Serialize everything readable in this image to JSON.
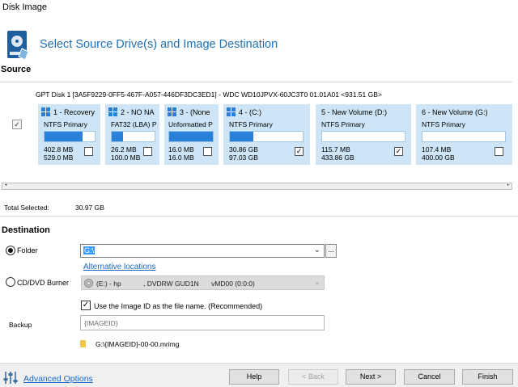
{
  "window": {
    "title": "Disk Image"
  },
  "header": {
    "title": "Select Source Drive(s) and Image Destination",
    "icon": "disk-image-icon"
  },
  "source": {
    "label": "Source",
    "disk_line": "GPT Disk 1 [3A5F9229-0FF5-467F-A057-446DF3DC3ED1] - WDC WD10JPVX-60JC3T0 01.01A01  <931.51 GB>",
    "disk_checked": "✓",
    "partitions": [
      {
        "title": "1 - Recovery",
        "type": "NTFS Primary",
        "used": "402.8 MB",
        "total": "529.0 MB",
        "fill": 0.76,
        "checked": ""
      },
      {
        "title": "2 - NO NA",
        "type": "FAT32 (LBA) P",
        "used": "26.2 MB",
        "total": "100.0 MB",
        "fill": 0.26,
        "checked": ""
      },
      {
        "title": "3 - (None",
        "type": "Unformatted P",
        "used": "16.0 MB",
        "total": "16.0 MB",
        "fill": 1.0,
        "checked": ""
      },
      {
        "title": "4 - (C:)",
        "type": "NTFS Primary",
        "used": "30.86 GB",
        "total": "97.03 GB",
        "fill": 0.32,
        "checked": "✓"
      },
      {
        "title": "5 - New Volume (D:)",
        "type": "NTFS Primary",
        "used": "115.7 MB",
        "total": "433.86 GB",
        "fill": 0.0,
        "checked": "✓"
      },
      {
        "title": "6 - New Volume (G:)",
        "type": "NTFS Primary",
        "used": "107.4 MB",
        "total": "400.00 GB",
        "fill": 0.0,
        "checked": ""
      }
    ],
    "scroll_left": "•",
    "scroll_right": "•"
  },
  "total": {
    "label": "Total Selected:",
    "value": "30.97 GB"
  },
  "destination": {
    "label": "Destination",
    "folder_label": "Folder",
    "folder_value": "G:\\",
    "browse_label": "...",
    "alt_link": "Alternative locations",
    "cd_label": "CD/DVD Burner",
    "cd_drive": "(E:) - hp",
    "cd_model": ", DVDRW GUD1N",
    "cd_dev": "vMD00 (0:0:0)",
    "imageid_checked": "✓",
    "imageid_label": "Use the Image ID as the file name.  (Recommended)",
    "backup_label": "Backup",
    "backup_value": "{IMAGEID}",
    "file_path": "G:\\{IMAGEID}-00-00.mrimg"
  },
  "footer": {
    "advanced_label": "Advanced Options",
    "help": "Help",
    "back": "< Back",
    "next": "Next >",
    "cancel": "Cancel",
    "finish": "Finish"
  }
}
